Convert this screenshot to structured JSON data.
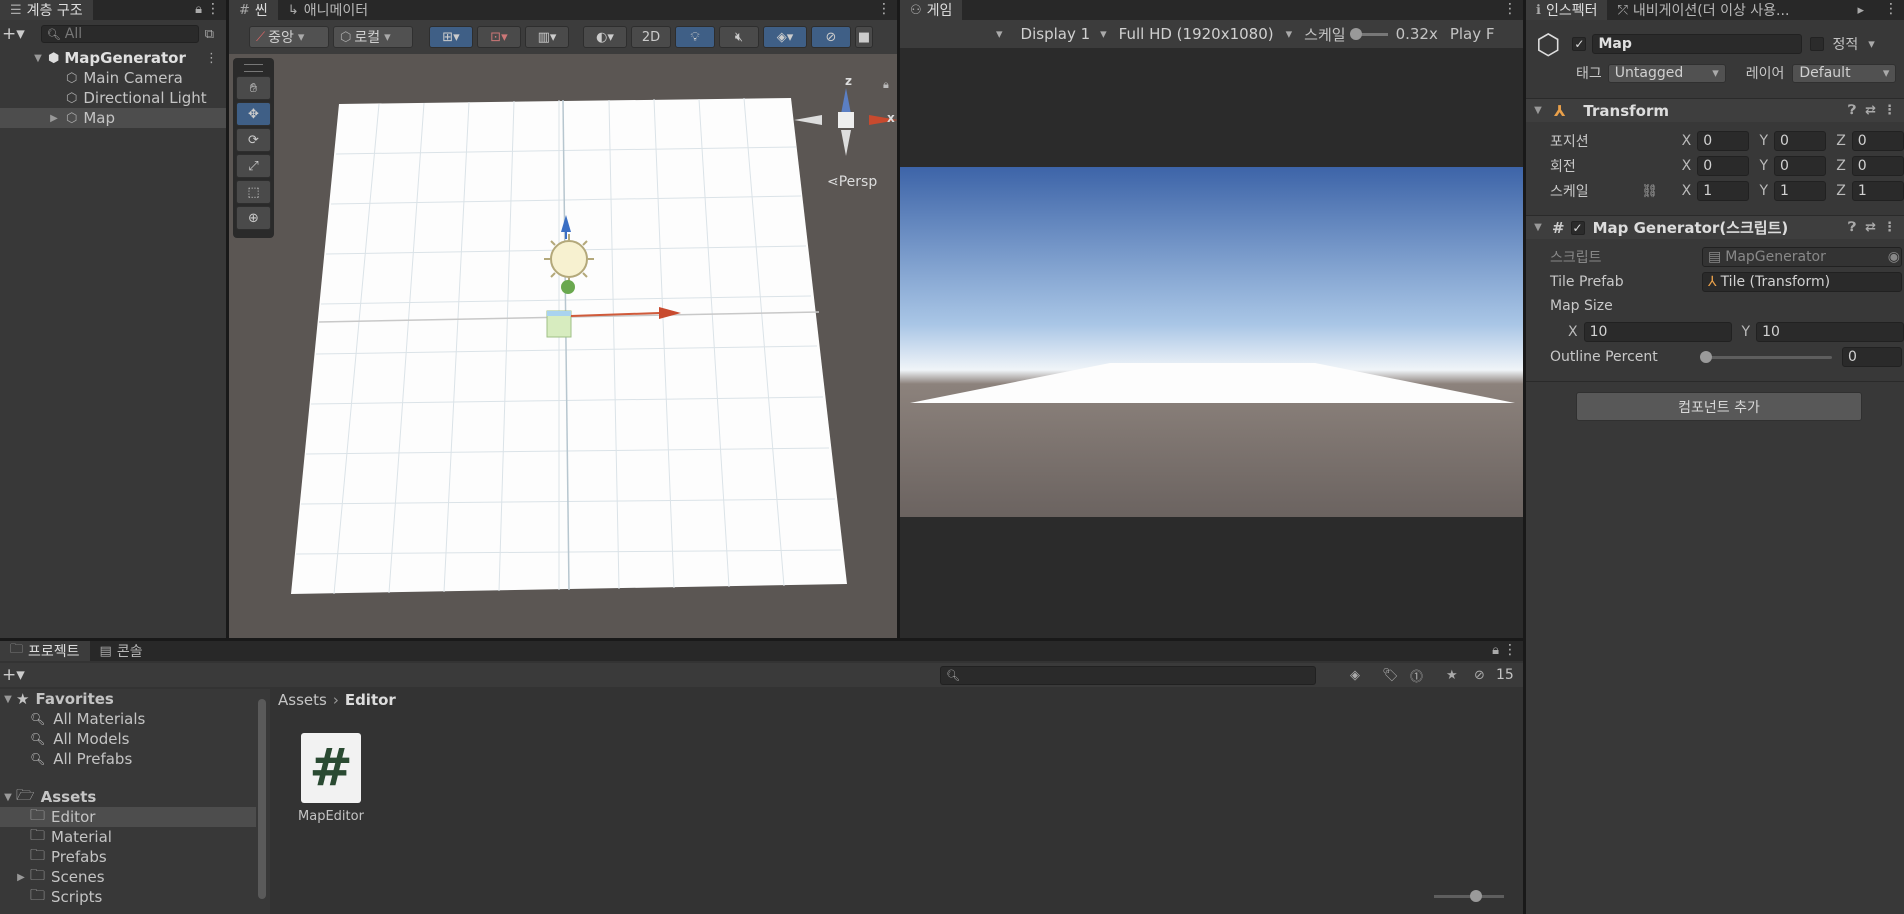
{
  "hierarchy": {
    "tab": "계층 구조",
    "search_placeholder": "All",
    "items": [
      "MapGenerator",
      "Main Camera",
      "Directional Light",
      "Map"
    ]
  },
  "scene": {
    "tabs": [
      "씬",
      "애니메이터"
    ],
    "pivot": "중앙",
    "space": "로컬",
    "mode_2d": "2D",
    "persp": "Persp",
    "gizmo_z": "z",
    "gizmo_x": "x"
  },
  "game": {
    "tab": "게임",
    "display": "Display 1",
    "resolution": "Full HD (1920x1080)",
    "scale_label": "스케일",
    "scale_value": "0.32x",
    "play": "Play F"
  },
  "inspector": {
    "tabs": [
      "인스펙터",
      "내비게이션(더 이상 사용..."
    ],
    "object_name": "Map",
    "static_label": "정적",
    "tag_label": "태그",
    "tag_value": "Untagged",
    "layer_label": "레이어",
    "layer_value": "Default",
    "transform": {
      "title": "Transform",
      "rows": [
        {
          "label": "포지션",
          "x": "0",
          "y": "0",
          "z": "0"
        },
        {
          "label": "회전",
          "x": "0",
          "y": "0",
          "z": "0"
        },
        {
          "label": "스케일",
          "x": "1",
          "y": "1",
          "z": "1"
        }
      ]
    },
    "script_comp": {
      "title": "Map Generator(스크립트)",
      "script_label": "스크립트",
      "script_value": "MapGenerator",
      "tile_label": "Tile Prefab",
      "tile_value": "Tile (Transform)",
      "mapsize_label": "Map Size",
      "mapsize_x": "10",
      "mapsize_y": "10",
      "outline_label": "Outline Percent",
      "outline_value": "0",
      "outline_fraction": 0
    },
    "add_component": "컴포넌트 추가"
  },
  "project": {
    "tabs": [
      "프로젝트",
      "콘솔"
    ],
    "hidden_count": "15",
    "favorites_label": "Favorites",
    "favorites": [
      "All Materials",
      "All Models",
      "All Prefabs"
    ],
    "assets_label": "Assets",
    "folders": [
      "Editor",
      "Material",
      "Prefabs",
      "Scenes",
      "Scripts"
    ],
    "breadcrumb_root": "Assets",
    "breadcrumb_current": "Editor",
    "file_icon_glyph": "#",
    "file_name": "MapEditor"
  },
  "colors": {
    "accent": "#3f5f86",
    "selected": "#4d4d4d"
  }
}
